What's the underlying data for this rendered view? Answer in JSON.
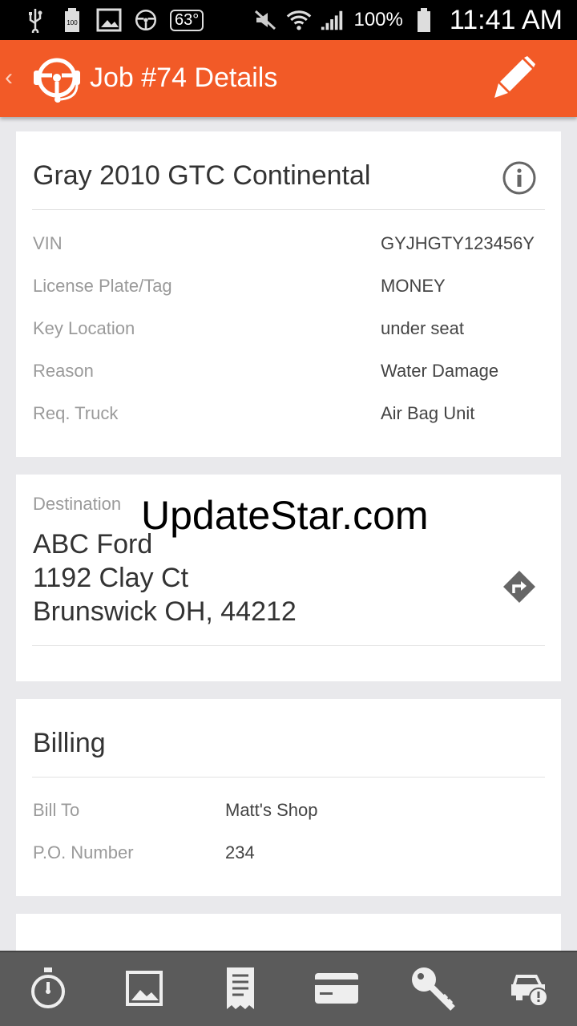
{
  "status_bar": {
    "temperature": "63°",
    "battery_percent": "100%",
    "time": "11:41 AM",
    "left_icons": [
      "usb-icon",
      "battery-saver-icon",
      "gallery-icon",
      "steering-wheel-icon"
    ],
    "right_icons": [
      "mute-icon",
      "wifi-icon",
      "signal-icon",
      "battery-icon"
    ]
  },
  "app_bar": {
    "title": "Job #74 Details",
    "icons": [
      "back-chevron-icon",
      "app-logo-icon",
      "edit-pencil-icon"
    ],
    "color": "#f25a27"
  },
  "vehicle": {
    "title": "Gray 2010 GTC Continental",
    "rows": [
      {
        "label": "VIN",
        "value": "GYJHGTY123456Y"
      },
      {
        "label": "License Plate/Tag",
        "value": "MONEY"
      },
      {
        "label": "Key Location",
        "value": "under seat"
      },
      {
        "label": "Reason",
        "value": "Water Damage"
      },
      {
        "label": "Req. Truck",
        "value": "Air Bag Unit"
      }
    ]
  },
  "destination": {
    "label": "Destination",
    "name": "ABC Ford",
    "street": "1192 Clay Ct",
    "city_state_zip": "Brunswick OH, 44212"
  },
  "watermark": "UpdateStar.com",
  "billing": {
    "title": "Billing",
    "rows": [
      {
        "label": "Bill To",
        "value": "Matt's Shop"
      },
      {
        "label": "P.O. Number",
        "value": "234"
      }
    ]
  },
  "bottom_tabs": [
    "stopwatch-icon",
    "photo-icon",
    "receipt-icon",
    "credit-card-icon",
    "key-icon",
    "car-alert-icon"
  ]
}
